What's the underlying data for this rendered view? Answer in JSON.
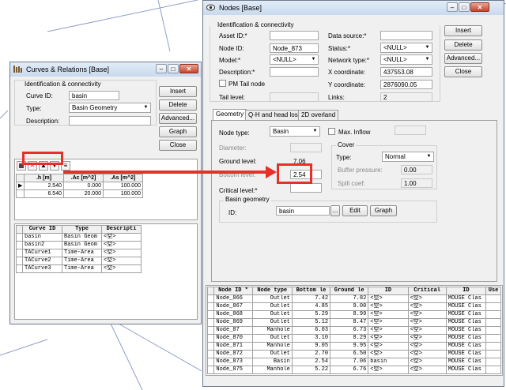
{
  "curves_window": {
    "title": "Curves & Relations [Base]",
    "group_label": "Identification & connectivity",
    "curve_id_label": "Curve ID:",
    "curve_id_value": "basin",
    "type_label": "Type:",
    "type_value": "Basin Geometry",
    "description_label": "Description:",
    "description_value": "",
    "buttons": {
      "insert": "Insert",
      "delete": "Delete",
      "advanced": "Advanced...",
      "graph": "Graph",
      "close": "Close"
    },
    "relation_table": {
      "headers": [
        ".h [m]",
        ".Ac [m^2]",
        ".As [m^2]"
      ],
      "rows": [
        [
          "2.540",
          "0.000",
          "100.000"
        ],
        [
          "6.540",
          "20.000",
          "100.000"
        ]
      ]
    },
    "curve_list": {
      "headers": [
        "Curve ID",
        "Type",
        "Descripti"
      ],
      "rows": [
        [
          "basin",
          "Basin Geom",
          "<空>"
        ],
        [
          "basin2",
          "Basin Geom",
          "<空>"
        ],
        [
          "TACurve1",
          "Time-Area",
          "<空>"
        ],
        [
          "TACurve2",
          "Time-Area",
          "<空>"
        ],
        [
          "TACurve3",
          "Time-Area",
          "<空>"
        ]
      ]
    }
  },
  "nodes_window": {
    "title": "Nodes [Base]",
    "group_label": "Identification & connectivity",
    "asset_id_label": "Asset ID:*",
    "asset_id_value": "",
    "node_id_label": "Node ID:",
    "node_id_value": "Node_873",
    "model_label": "Model:*",
    "model_value": "<NULL>",
    "description_label": "Description:*",
    "description_value": "",
    "pm_tail_label": "PM Tail node",
    "tail_level_label": "Tail level:",
    "tail_level_value": "",
    "data_source_label": "Data source:*",
    "data_source_value": "",
    "status_label": "Status:*",
    "status_value": "<NULL>",
    "network_type_label": "Network type:*",
    "network_type_value": "<NULL>",
    "x_label": "X coordinate:",
    "x_value": "437553.08",
    "y_label": "Y coordinate:",
    "y_value": "2876090.05",
    "links_label": "Links:",
    "links_value": "2",
    "buttons": {
      "insert": "Insert",
      "delete": "Delete",
      "advanced": "Advanced...",
      "close": "Close"
    },
    "tabs": [
      "Geometry",
      "Q-H and head loss",
      "2D overland"
    ],
    "geometry": {
      "node_type_label": "Node type:",
      "node_type_value": "Basin",
      "max_inflow_label": "Max. Inflow",
      "max_inflow_value": "",
      "diameter_label": "Diameter:",
      "diameter_value": "",
      "ground_level_label": "Ground level:",
      "ground_level_value": "7.06",
      "bottom_level_label": "Bottom level:",
      "bottom_level_value": "2.54",
      "critical_level_label": "Critical level:*",
      "critical_level_value": "",
      "cover_label": "Cover",
      "cover_type_label": "Type:",
      "cover_type_value": "Normal",
      "buffer_pressure_label": "Buffer pressure:",
      "buffer_pressure_value": "0.00",
      "spill_coef_label": "Spill coef:",
      "spill_coef_value": "1.00",
      "basin_geometry_label": "Basin geometry",
      "basin_id_label": "ID:",
      "basin_id_value": "basin",
      "browse_label": "...",
      "edit_label": "Edit",
      "graph_label": "Graph"
    },
    "node_table": {
      "headers": [
        "Node ID *",
        "Node type",
        "Bottom le",
        "Ground le",
        "ID",
        "Critical",
        "ID",
        "Use"
      ],
      "rows": [
        [
          "Node_866",
          "Outlet",
          "7.42",
          "7.82",
          "<空>",
          "<空>",
          "MOUSE Clas",
          ""
        ],
        [
          "Node_867",
          "Outlet",
          "4.85",
          "9.00",
          "<空>",
          "<空>",
          "MOUSE Clas",
          ""
        ],
        [
          "Node_868",
          "Outlet",
          "5.29",
          "8.99",
          "<空>",
          "<空>",
          "MOUSE Clas",
          ""
        ],
        [
          "Node_869",
          "Outlet",
          "5.12",
          "8.47",
          "<空>",
          "<空>",
          "MOUSE Clas",
          ""
        ],
        [
          "Node_87",
          "Manhole",
          "6.03",
          "6.73",
          "<空>",
          "<空>",
          "MOUSE Clas",
          ""
        ],
        [
          "Node_870",
          "Outlet",
          "3.10",
          "8.29",
          "<空>",
          "<空>",
          "MOUSE Clas",
          ""
        ],
        [
          "Node_871",
          "Manhole",
          "9.05",
          "9.95",
          "<空>",
          "<空>",
          "MOUSE Clas",
          ""
        ],
        [
          "Node_872",
          "Outlet",
          "2.70",
          "6.50",
          "<空>",
          "<空>",
          "MOUSE Clas",
          ""
        ],
        [
          "Node_873",
          "Basin",
          "2.54",
          "7.06",
          "basin",
          "<空>",
          "MOUSE Clas",
          ""
        ],
        [
          "Node_875",
          "Manhole",
          "5.22",
          "6.76",
          "<空>",
          "<空>",
          "MOUSE Clas",
          ""
        ]
      ]
    }
  },
  "colors": {
    "highlight": "#e8302a",
    "titlebar": "#c9d9ee",
    "close_button": "#c8432a"
  }
}
